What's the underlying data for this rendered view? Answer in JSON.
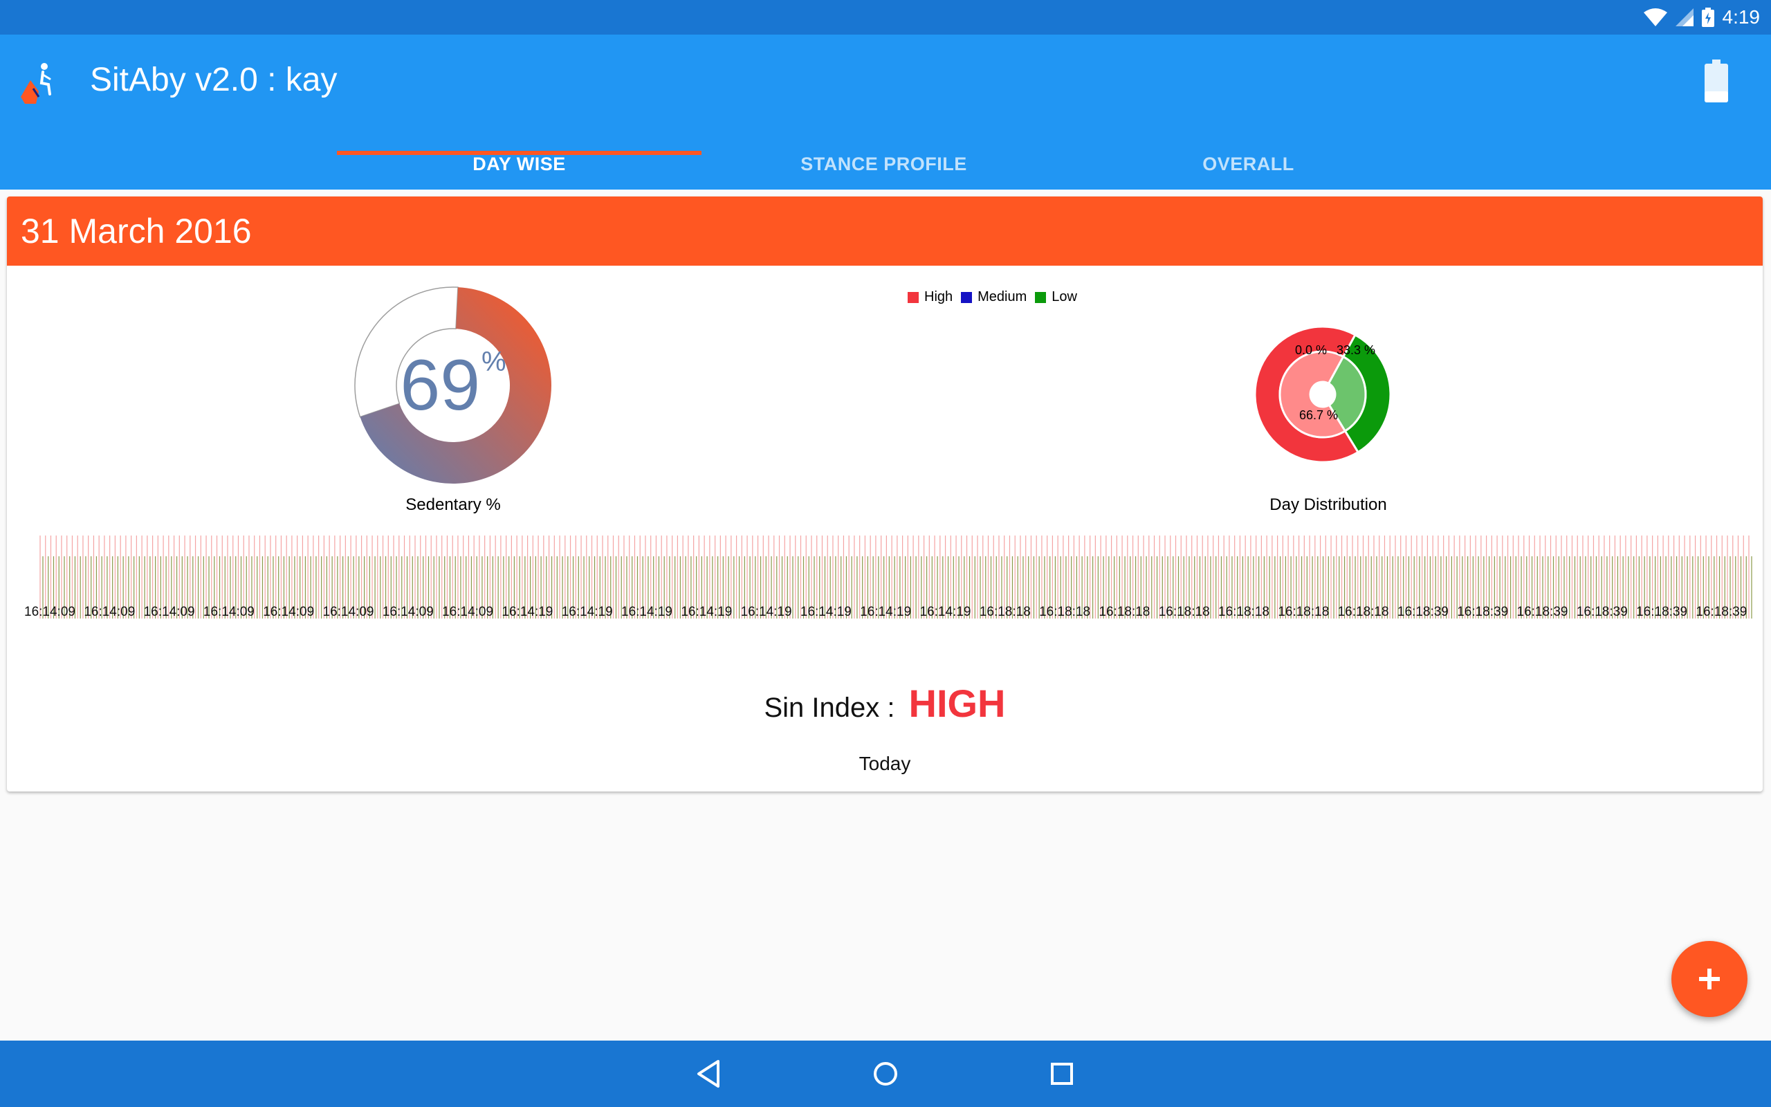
{
  "status_bar": {
    "time": "4:19",
    "icons": [
      "wifi-icon",
      "cell-signal-icon",
      "battery-charging-icon"
    ]
  },
  "app_bar": {
    "title": "SitAby v2.0 : kay",
    "logo_icon": "sitting-person-icon",
    "action_icon": "battery-icon"
  },
  "tabs": [
    {
      "label": "DAY WISE",
      "active": true
    },
    {
      "label": "STANCE PROFILE",
      "active": false
    },
    {
      "label": "OVERALL",
      "active": false
    }
  ],
  "card": {
    "date": "31 March 2016",
    "sedentary": {
      "value": "69",
      "unit": "%",
      "label": "Sedentary %"
    },
    "distribution_label": "Day Distribution",
    "sin_index": {
      "label": "Sin Index :",
      "value": "HIGH"
    },
    "period": "Today"
  },
  "colors": {
    "primary": "#2196f3",
    "primary_dark": "#1976d2",
    "accent": "#ff5722",
    "high": "#f2353d",
    "medium": "#1512c4",
    "low": "#0b9a0b"
  },
  "chart_data": [
    {
      "type": "pie",
      "subtype": "donut-gauge",
      "values": [
        69,
        31
      ],
      "center_text": "69%",
      "xlabel": "Sedentary %"
    },
    {
      "type": "pie",
      "legend": [
        "High",
        "Medium",
        "Low"
      ],
      "legend_position": "top",
      "categories": [
        "High",
        "Medium",
        "Low"
      ],
      "values": [
        66.7,
        0.0,
        33.3
      ],
      "data_labels": [
        "66.7 %",
        "0.0 %",
        "33.3 %"
      ],
      "xlabel": "Day Distribution"
    },
    {
      "type": "bar",
      "subtype": "timeline",
      "x_tick_labels": [
        "16:14:09",
        "16:14:09",
        "16:14:09",
        "16:14:09",
        "16:14:09",
        "16:14:09",
        "16:14:09",
        "16:14:09",
        "16:14:19",
        "16:14:19",
        "16:14:19",
        "16:14:19",
        "16:14:19",
        "16:14:19",
        "16:14:19",
        "16:14:19",
        "16:18:18",
        "16:18:18",
        "16:18:18",
        "16:18:18",
        "16:18:18",
        "16:18:18",
        "16:18:18",
        "16:18:39",
        "16:18:39",
        "16:18:39",
        "16:18:39",
        "16:18:39",
        "16:18:39",
        "16:18:39"
      ],
      "bar_count": 320,
      "grid": false
    }
  ]
}
